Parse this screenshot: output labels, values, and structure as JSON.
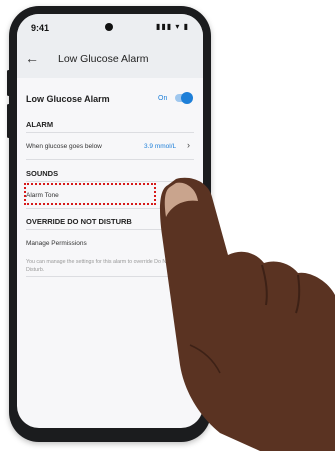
{
  "status_bar": {
    "time": "9:41",
    "icons": "▮▮▮ ▾ ▮"
  },
  "app_bar": {
    "title": "Low Glucose Alarm",
    "back_icon": "arrow-left-icon"
  },
  "main_toggle": {
    "label": "Low Glucose Alarm",
    "state_text": "On",
    "enabled": true
  },
  "sections": {
    "alarm": {
      "header": "ALARM",
      "row_label": "When glucose goes below",
      "row_value": "3.9 mmol/L"
    },
    "sounds": {
      "header": "SOUNDS",
      "row_label": "Alarm Tone"
    },
    "override": {
      "header": "OVERRIDE DO NOT DISTURB",
      "row_label": "Manage Permissions",
      "helper_text": "You can manage the settings for this alarm to override Do Not Disturb."
    }
  },
  "colors": {
    "accent": "#1e7fd8",
    "highlight": "#d71a1a",
    "appbar": "#eceef1"
  }
}
